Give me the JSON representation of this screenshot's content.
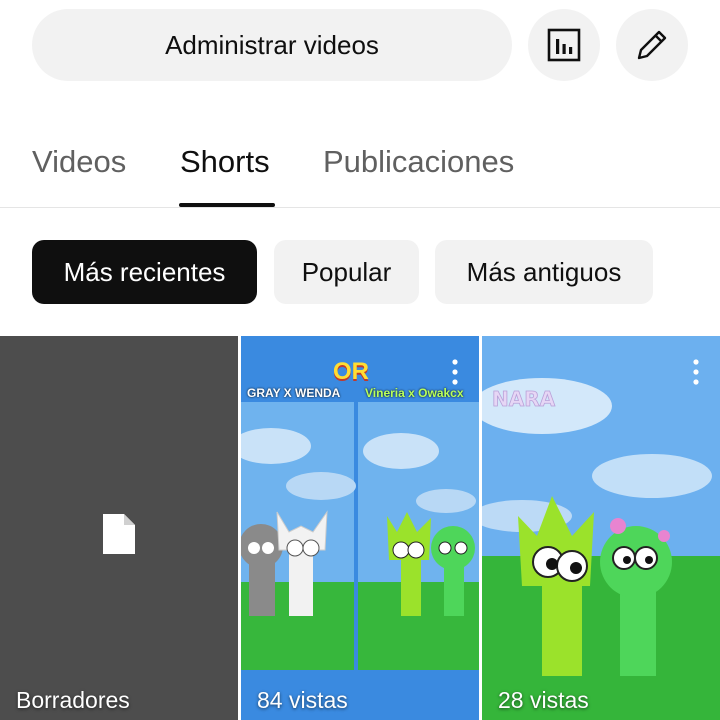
{
  "header": {
    "manage_label": "Administrar videos",
    "analytics_icon": "analytics-bar-chart-icon",
    "edit_icon": "pencil-edit-icon"
  },
  "tabs": [
    {
      "label": "Videos",
      "active": false
    },
    {
      "label": "Shorts",
      "active": true
    },
    {
      "label": "Publicaciones",
      "active": false
    }
  ],
  "filters": [
    {
      "label": "Más recientes",
      "selected": true
    },
    {
      "label": "Popular",
      "selected": false
    },
    {
      "label": "Más antiguos",
      "selected": false
    }
  ],
  "grid": {
    "drafts": {
      "label": "Borradores",
      "icon": "document-icon"
    },
    "shorts": [
      {
        "views": "84 vistas",
        "thumb_text": {
          "top": "OR",
          "left": "GRAY X WENDA",
          "right": "Vineria x Owakcx"
        }
      },
      {
        "views": "28 vistas",
        "thumb_text": {}
      }
    ]
  },
  "colors": {
    "chip_selected_bg": "#0f0f0f",
    "chip_bg": "#f2f2f2",
    "drafts_bg": "#4d4d4d",
    "sky_blue": "#5ea3e8",
    "grass_green": "#35b53a",
    "character_green": "#9be22b"
  }
}
